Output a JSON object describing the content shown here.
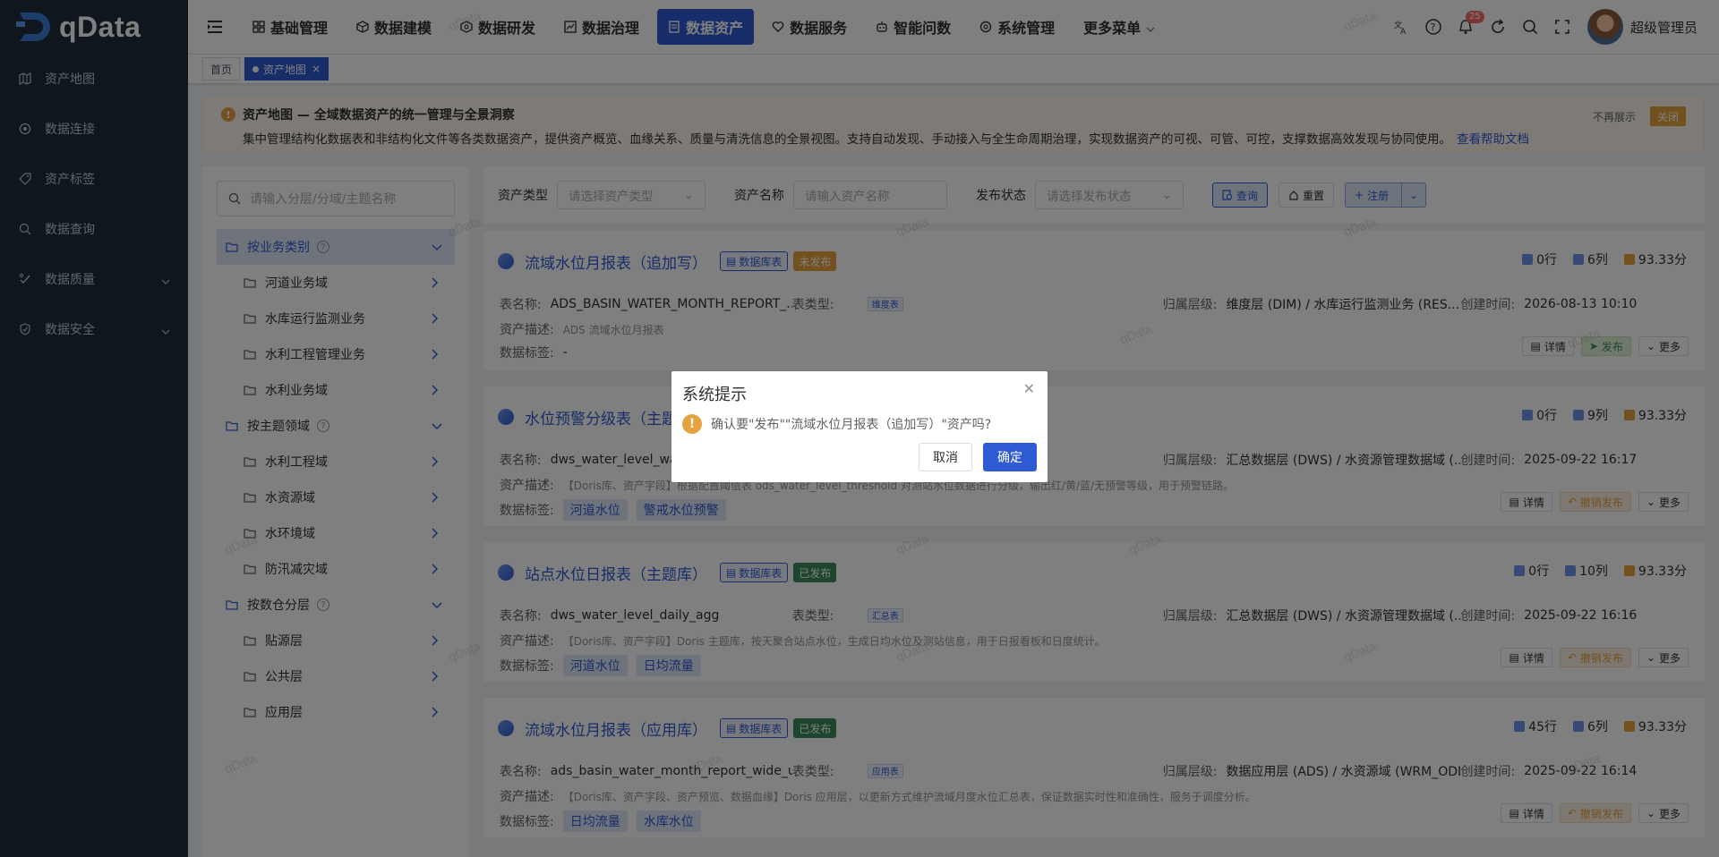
{
  "app": {
    "logo_text": "qData"
  },
  "sidebar": {
    "items": [
      {
        "label": "资产地图",
        "icon": "map-icon"
      },
      {
        "label": "数据连接",
        "icon": "link-icon"
      },
      {
        "label": "资产标签",
        "icon": "tag-icon"
      },
      {
        "label": "数据查询",
        "icon": "query-icon"
      },
      {
        "label": "数据质量",
        "icon": "quality-icon",
        "expandable": true
      },
      {
        "label": "数据安全",
        "icon": "shield-icon",
        "expandable": true
      }
    ]
  },
  "topnav": {
    "items": [
      {
        "label": "基础管理",
        "icon": "grid-icon"
      },
      {
        "label": "数据建模",
        "icon": "cube-icon"
      },
      {
        "label": "数据研发",
        "icon": "code-icon"
      },
      {
        "label": "数据治理",
        "icon": "chart-icon"
      },
      {
        "label": "数据资产",
        "icon": "asset-icon",
        "active": true
      },
      {
        "label": "数据服务",
        "icon": "service-icon"
      },
      {
        "label": "智能问数",
        "icon": "ai-icon"
      },
      {
        "label": "系统管理",
        "icon": "settings-icon"
      },
      {
        "label": "更多菜单",
        "icon": "chevron-down-icon"
      }
    ],
    "notification_count": "25",
    "user_name": "超级管理员"
  },
  "tags": {
    "home": "首页",
    "active": "资产地图"
  },
  "notice": {
    "title": "资产地图 — 全域数据资产的统一管理与全景洞察",
    "desc": "集中管理结构化数据表和非结构化文件等各类数据资产，提供资产概览、血缘关系、质量与清洗信息的全景视图。支持自动发现、手动接入与全生命周期治理，实现数据资产的可视、可管、可控，支撑数据高效发现与协同使用。",
    "link": "查看帮助文档",
    "hide_btn": "不再展示",
    "close_btn": "关闭"
  },
  "tree": {
    "search_placeholder": "请输入分层/分域/主题名称",
    "groups": [
      {
        "label": "按业务类别",
        "children": [
          "河道业务域",
          "水库运行监测业务",
          "水利工程管理业务",
          "水利业务域"
        ]
      },
      {
        "label": "按主题领域",
        "children": [
          "水利工程域",
          "水资源域",
          "水环境域",
          "防汛减灾域"
        ]
      },
      {
        "label": "按数仓分层",
        "children": [
          "贴源层",
          "公共层",
          "应用层"
        ]
      }
    ]
  },
  "filter": {
    "type_label": "资产类型",
    "type_placeholder": "请选择资产类型",
    "name_label": "资产名称",
    "name_placeholder": "请输入资产名称",
    "status_label": "发布状态",
    "status_placeholder": "请选择发布状态",
    "query_btn": "查询",
    "reset_btn": "重置",
    "register_btn": "注册"
  },
  "labels": {
    "table_name": "表名称:",
    "table_type": "表类型:",
    "layer": "归属层级:",
    "created": "创建时间:",
    "desc": "资产描述:",
    "tags": "数据标签:",
    "db_badge": "数据库表",
    "detail": "详情",
    "more": "更多"
  },
  "cards": [
    {
      "title": "流域水位月报表（追加写）",
      "status": "未发布",
      "rows": "0行",
      "cols": "6列",
      "score": "93.33分",
      "table_name": "ADS_BASIN_WATER_MONTH_REPORT_...",
      "table_type": "维度表",
      "layer": "维度层 (DIM) / 水库运行监测业务 (RES...",
      "created": "2026-08-13 10:10",
      "desc": "ADS 流域水位月报表",
      "tags_text": "-",
      "tags": [],
      "action": "发布"
    },
    {
      "title": "水位预警分级表（主题库）",
      "status": "",
      "rows": "0行",
      "cols": "9列",
      "score": "93.33分",
      "table_name": "dws_water_level_warn...",
      "table_type": "",
      "layer": "汇总数据层 (DWS) / 水资源管理数据域 (...",
      "created": "2025-09-22 16:17",
      "desc": "【Doris库、资产字段】根据配置阈值表 ods_water_level_threshold 对测站水位数据进行分级，输出红/黄/蓝/无预警等级，用于预警链路。",
      "tags_text": "",
      "tags": [
        "河道水位",
        "警戒水位预警"
      ],
      "action": "撤销发布"
    },
    {
      "title": "站点水位日报表（主题库）",
      "status": "已发布",
      "rows": "0行",
      "cols": "10列",
      "score": "93.33分",
      "table_name": "dws_water_level_daily_agg",
      "table_type": "汇总表",
      "layer": "汇总数据层 (DWS) / 水资源管理数据域 (...",
      "created": "2025-09-22 16:16",
      "desc": "【Doris库、资产字段】Doris 主题库，按天聚合站点水位，生成日均水位及测站信息，用于日报看板和日度统计。",
      "tags_text": "",
      "tags": [
        "河道水位",
        "日均流量"
      ],
      "action": "撤销发布"
    },
    {
      "title": "流域水位月报表（应用库）",
      "status": "已发布",
      "rows": "45行",
      "cols": "6列",
      "score": "93.33分",
      "table_name": "ads_basin_water_month_report_wide_up...",
      "table_type": "应用表",
      "layer": "数据应用层 (ADS) / 水资源域 (WRM_ODL)",
      "created": "2025-09-22 16:14",
      "desc": "【Doris库、资产字段、资产预览、数据血缘】Doris 应用层，以更新方式维护流域月度水位汇总表，保证数据实时性和准确性，服务于调度分析。",
      "tags_text": "",
      "tags": [
        "日均流量",
        "水库水位"
      ],
      "action": "撤销发布"
    }
  ],
  "watermark": "qData",
  "dialog": {
    "title": "系统提示",
    "message": "确认要\"发布\"\"流域水位月报表（追加写）\"资产吗?",
    "cancel": "取消",
    "confirm": "确定"
  }
}
